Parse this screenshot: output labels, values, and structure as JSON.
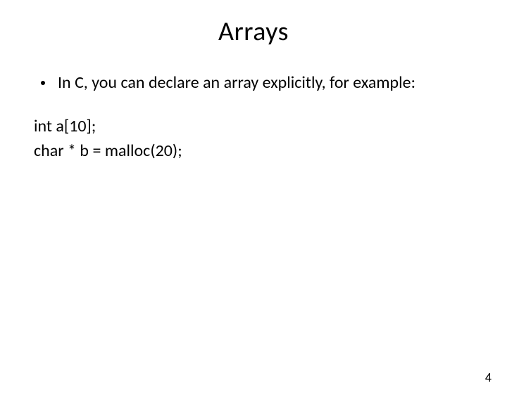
{
  "title": "Arrays",
  "bullet": "In C, you can declare an array explicitly, for example:",
  "code": {
    "line1": "int a[10];",
    "line2": "char * b = malloc(20);"
  },
  "pageNumber": "4"
}
